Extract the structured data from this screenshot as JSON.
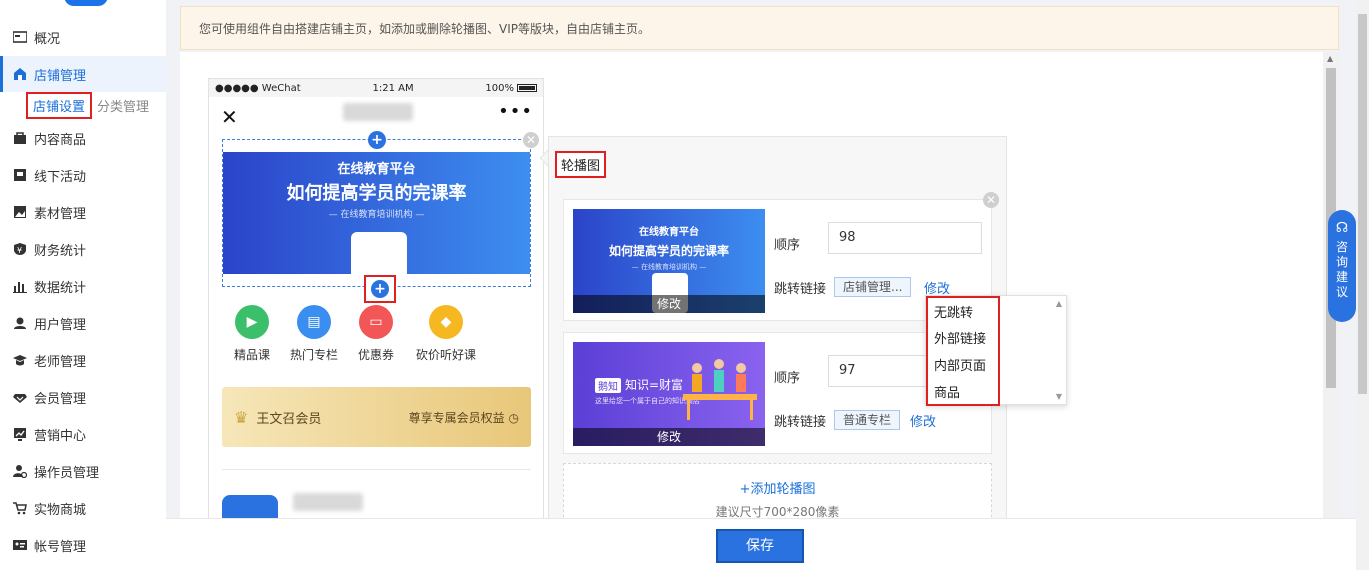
{
  "sidebar": {
    "items": [
      {
        "label": "概况",
        "icon": "dashboard-icon"
      },
      {
        "label": "店铺管理",
        "icon": "store-icon"
      },
      {
        "label": "内容商品",
        "icon": "bag-icon"
      },
      {
        "label": "线下活动",
        "icon": "flag-icon"
      },
      {
        "label": "素材管理",
        "icon": "image-icon"
      },
      {
        "label": "财务统计",
        "icon": "yen-shield-icon"
      },
      {
        "label": "数据统计",
        "icon": "bar-chart-icon"
      },
      {
        "label": "用户管理",
        "icon": "user-icon"
      },
      {
        "label": "老师管理",
        "icon": "graduation-cap-icon"
      },
      {
        "label": "会员管理",
        "icon": "vip-diamond-icon"
      },
      {
        "label": "营销中心",
        "icon": "trend-icon"
      },
      {
        "label": "操作员管理",
        "icon": "operator-icon"
      },
      {
        "label": "实物商城",
        "icon": "cart-icon"
      },
      {
        "label": "帐号管理",
        "icon": "id-card-icon"
      }
    ],
    "sub": {
      "active": "店铺设置",
      "inactive": "分类管理"
    }
  },
  "notice": "您可使用组件自由搭建店铺主页，如添加或删除轮播图、VIP等版块，自由店铺主页。",
  "phone": {
    "carrier": "●●●●● WeChat",
    "time": "1:21 AM",
    "battery": "100%",
    "banner": {
      "sub": "在线教育平台",
      "main": "如何提高学员的完课率",
      "tiny": "— 在线教育培训机构 —"
    },
    "shortcuts": [
      {
        "label": "精品课",
        "color": "#3cbf6a"
      },
      {
        "label": "热门专栏",
        "color": "#3a8ef0"
      },
      {
        "label": "优惠券",
        "color": "#f25656"
      },
      {
        "label": "砍价听好课",
        "color": "#f5b821"
      }
    ],
    "vip": {
      "name": "王文召会员",
      "rights": "尊享专属会员权益"
    }
  },
  "panel": {
    "title": "轮播图",
    "items": [
      {
        "thumb": {
          "sub": "在线教育平台",
          "main": "如何提高学员的完课率",
          "tiny": "— 在线教育培训机构 —"
        },
        "edit": "修改",
        "order_label": "顺序",
        "order": "98",
        "link_label": "跳转链接",
        "link": "店铺管理...",
        "link_edit": "修改"
      },
      {
        "thumb": {
          "tag": "鹅知",
          "main": "知识=财富",
          "tiny": "这里给您一个属于自己的知识商店"
        },
        "edit": "修改",
        "order_label": "顺序",
        "order": "97",
        "link_label": "跳转链接",
        "link": "普通专栏",
        "link_edit": "修改"
      }
    ],
    "add": "+添加轮播图",
    "hint": "建议尺寸700*280像素"
  },
  "dropdown": {
    "options": [
      "无跳转",
      "外部链接",
      "内部页面",
      "商品"
    ]
  },
  "consult": "咨询建议",
  "footer": {
    "save": "保存"
  },
  "colors": {
    "primary": "#2a72e0",
    "highlight": "#e02020",
    "notice_bg": "#fdf5e9"
  }
}
